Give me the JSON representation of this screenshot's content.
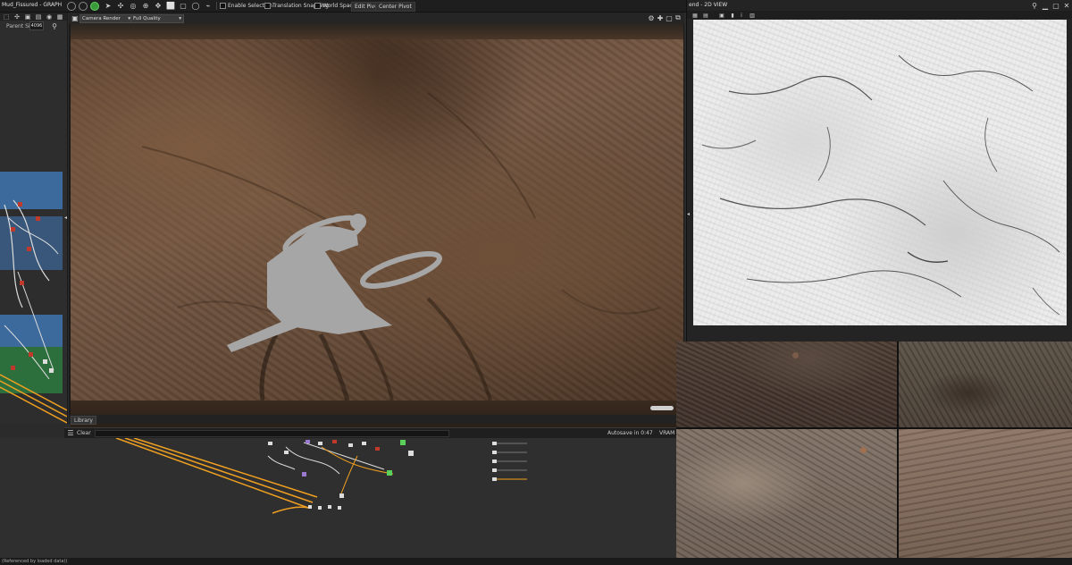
{
  "app": {
    "graph_title": "Mud_Fissured - GRAPH"
  },
  "toolbar": {
    "enable_selection": "Enable Selection",
    "translation_snapping": "Translation Snapping",
    "world_space": "World Space",
    "edit_pivot": "Edit Pivot",
    "center_pivot": "Center Pivot"
  },
  "left_panel": {
    "parent_size_label": "Parent Size:",
    "parent_size_value": "4096"
  },
  "viewport": {
    "camera_dropdown": "Camera Render",
    "quality_dropdown": "Full Quality"
  },
  "library": {
    "tab_label": "Library"
  },
  "console": {
    "clear_label": "Clear",
    "autosave": "Autosave in 0:47",
    "vram": "VRAM"
  },
  "view2d": {
    "title": "end - 2D VIEW"
  },
  "status": {
    "text": "(Referenced by loaded data))"
  },
  "colors": {
    "accent_orange": "#f0a020",
    "frame_blue": "#3d6a9c",
    "frame_green": "#2c6e3c",
    "node_red": "#c0392b"
  }
}
